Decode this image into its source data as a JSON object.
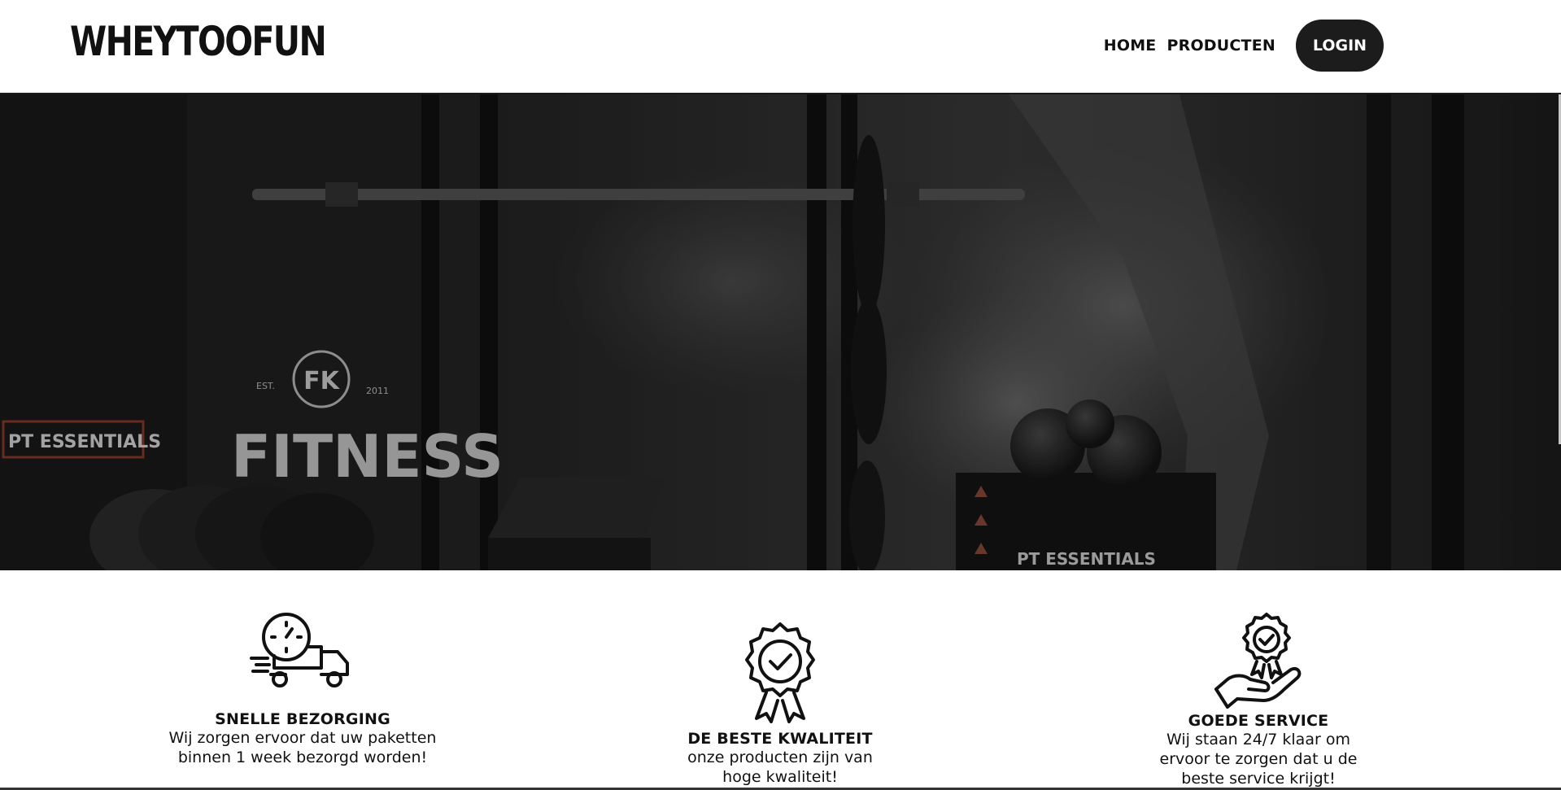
{
  "header": {
    "logo": "WHEYTOOFUN",
    "nav": [
      {
        "label": "HOME"
      },
      {
        "label": "PRODUCTEN"
      }
    ],
    "login_label": "LOGIN"
  },
  "hero": {
    "sign_brand": "PT ESSENTIALS",
    "gym_sign": "FITNESS",
    "gym_badge": "FK",
    "est_label": "EST.",
    "year_label": "2011",
    "box_brand": "PT ESSENTIALS"
  },
  "features": [
    {
      "icon": "delivery-truck-icon",
      "title": "SNELLE BEZORGING",
      "text": "Wij zorgen ervoor dat uw paketten binnen 1 week bezorgd worden!"
    },
    {
      "icon": "quality-badge-icon",
      "title": "DE BESTE KWALITEIT",
      "text": "onze producten zijn van hoge kwaliteit!"
    },
    {
      "icon": "service-hand-icon",
      "title": "GOEDE SERVICE",
      "text": "Wij staan 24/7 klaar om ervoor te zorgen dat u de beste service krijgt!"
    }
  ]
}
